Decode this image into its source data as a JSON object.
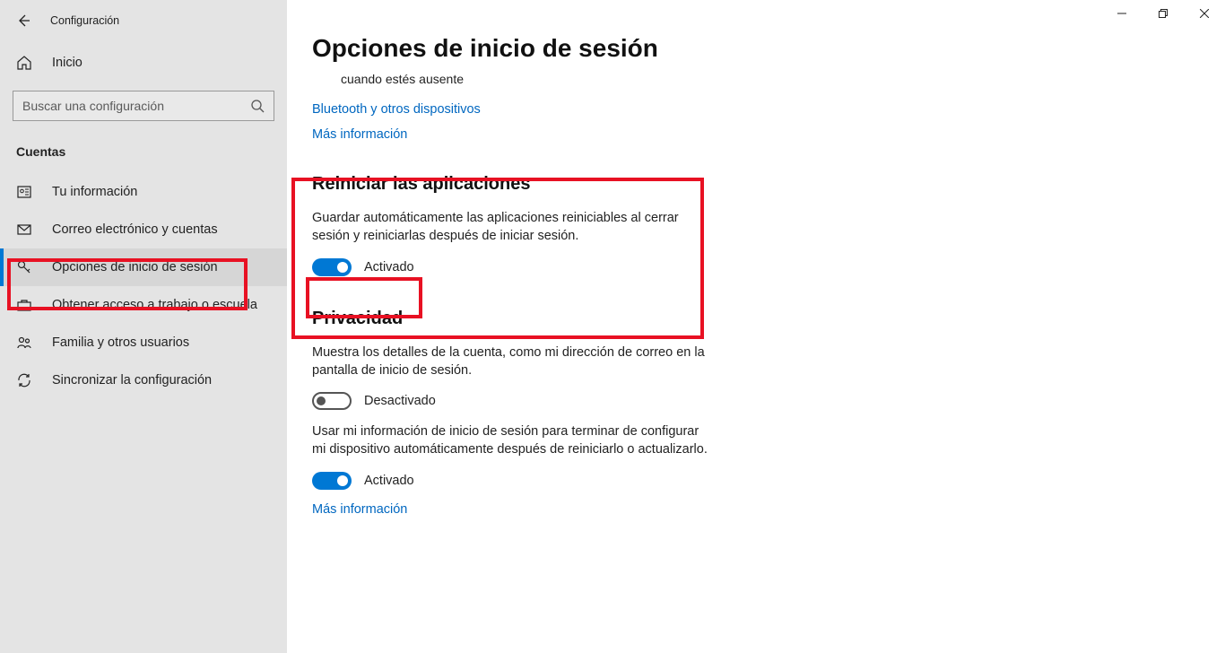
{
  "window": {
    "title": "Configuración",
    "home": "Inicio",
    "search_placeholder": "Buscar una configuración",
    "section": "Cuentas"
  },
  "nav": {
    "items": [
      {
        "label": "Tu información"
      },
      {
        "label": "Correo electrónico y cuentas"
      },
      {
        "label": "Opciones de inicio de sesión"
      },
      {
        "label": "Obtener acceso a trabajo o escuela"
      },
      {
        "label": "Familia y otros usuarios"
      },
      {
        "label": "Sincronizar la configuración"
      }
    ]
  },
  "page": {
    "title": "Opciones de inicio de sesión",
    "scroll_note": "cuando estés ausente",
    "link_bluetooth": "Bluetooth y otros dispositivos",
    "link_more_info": "Más información",
    "restart_apps": {
      "heading": "Reiniciar las aplicaciones",
      "desc": "Guardar automáticamente las aplicaciones reiniciables al cerrar sesión y reiniciarlas después de iniciar sesión.",
      "state": "Activado"
    },
    "privacy": {
      "heading": "Privacidad",
      "desc1": "Muestra los detalles de la cuenta, como mi dirección de correo en la pantalla de inicio de sesión.",
      "state1": "Desactivado",
      "desc2": "Usar mi información de inicio de sesión para terminar de configurar mi dispositivo automáticamente después de reiniciarlo o actualizarlo.",
      "state2": "Activado",
      "link": "Más información"
    }
  }
}
